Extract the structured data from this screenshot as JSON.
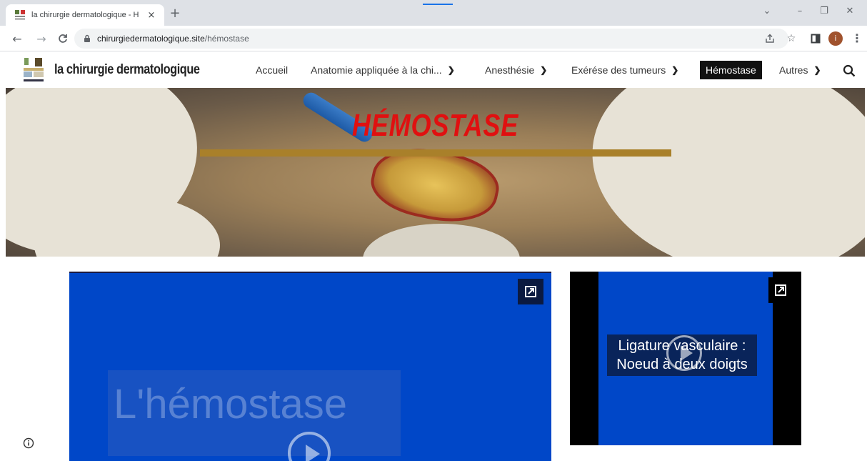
{
  "browser": {
    "tab_title": "la chirurgie dermatologique - H",
    "close_glyph": "×",
    "new_tab_glyph": "+",
    "url_host": "chirurgiedermatologique.site",
    "url_path": "/hémostase",
    "avatar_letter": "i"
  },
  "site": {
    "title": "la chirurgie dermatologique",
    "nav": [
      {
        "label": "Accueil"
      },
      {
        "label": "Anatomie appliquée à la chi..."
      },
      {
        "label": "Anesthésie"
      },
      {
        "label": "Exérése des tumeurs"
      },
      {
        "label": "Hémostase"
      },
      {
        "label": "Autres"
      }
    ]
  },
  "hero": {
    "title": "HÉMOSTASE"
  },
  "videos": {
    "main_caption": "L'hémostase",
    "side_caption": "Ligature vasculaire :\nNoeud à deux doigts"
  },
  "icons": {
    "tab_close": "close-icon",
    "back": "arrow-left-icon",
    "forward": "arrow-right-icon",
    "reload": "reload-icon",
    "share": "share-icon",
    "star": "star-icon",
    "sidepanel": "side-panel-icon",
    "search": "search-icon",
    "external": "external-link-icon",
    "info": "info-icon"
  },
  "colors": {
    "hero_title": "#e01010",
    "hero_bar": "#a9802a",
    "active_nav_bg": "#111111",
    "video_blue": "#0047c8"
  }
}
